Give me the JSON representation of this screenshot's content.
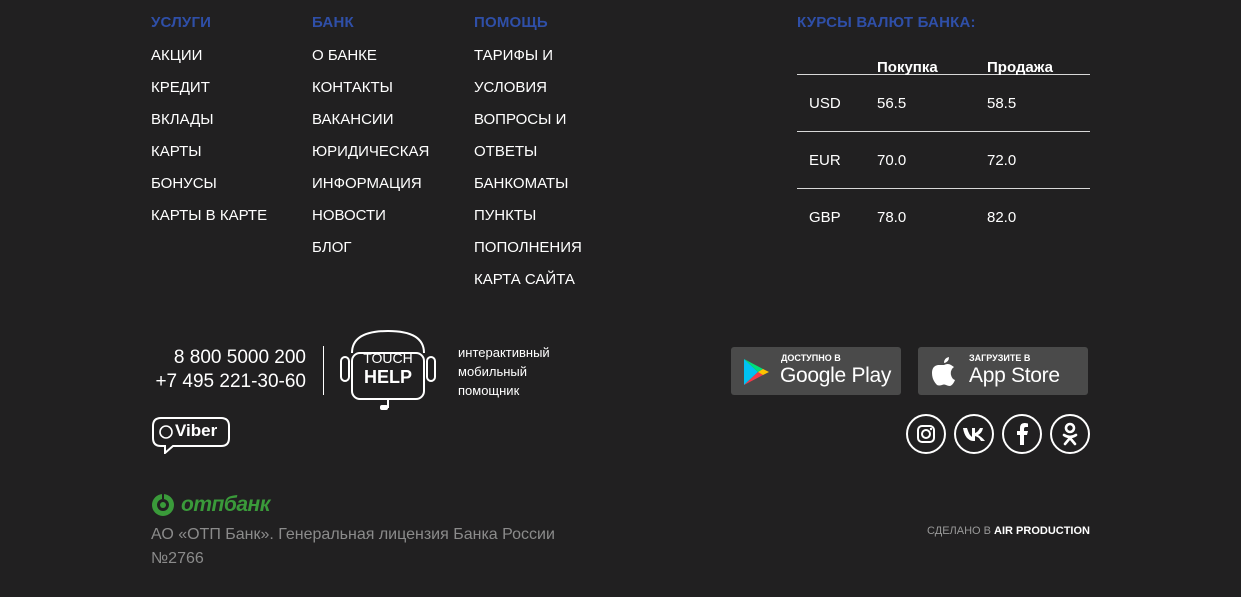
{
  "nav": {
    "services": {
      "title": "УСЛУГИ",
      "items": [
        "АКЦИИ",
        "КРЕДИТ",
        "ВКЛАДЫ",
        "КАРТЫ",
        "БОНУСЫ",
        "КАРТЫ В КАРТЕ"
      ]
    },
    "bank": {
      "title": "БАНК",
      "items": [
        "О БАНКЕ",
        "КОНТАКТЫ",
        "ВАКАНСИИ",
        "ЮРИДИЧЕСКАЯ",
        "ИНФОРМАЦИЯ",
        "НОВОСТИ",
        "БЛОГ"
      ]
    },
    "help": {
      "title": "ПОМОЩЬ",
      "items": [
        "ТАРИФЫ И",
        "УСЛОВИЯ",
        "ВОПРОСЫ И",
        "ОТВЕТЫ",
        "БАНКОМАТЫ",
        "ПУНКТЫ",
        "ПОПОЛНЕНИЯ",
        "КАРТА САЙТА"
      ]
    }
  },
  "rates": {
    "title": "КУРСЫ ВАЛЮТ БАНКА:",
    "buy_label": "Покупка",
    "sell_label": "Продажа",
    "rows": [
      {
        "currency": "USD",
        "buy": "56.5",
        "sell": "58.5"
      },
      {
        "currency": "EUR",
        "buy": "70.0",
        "sell": "72.0"
      },
      {
        "currency": "GBP",
        "buy": "78.0",
        "sell": "82.0"
      }
    ]
  },
  "contacts": {
    "phone1": "8 800 5000 200",
    "phone2": "+7 495 221-30-60",
    "touch_line1": "TOUCH",
    "touch_line2": "HELP",
    "touch_desc": [
      "интерактивный",
      "мобильный",
      "помощник"
    ],
    "viber": "Viber"
  },
  "apps": {
    "google": {
      "small": "ДОСТУПНО В",
      "big": "Google Play"
    },
    "apple": {
      "small": "ЗАГРУЗИТЕ В",
      "big": "App Store"
    }
  },
  "social": [
    "instagram-icon",
    "vk-icon",
    "facebook-icon",
    "odnoklassniki-icon"
  ],
  "footer": {
    "logo_text": "отпбанк",
    "license_line1": "АО «ОТП Банк». Генеральная лицензия Банка России",
    "license_line2": "№2766",
    "credit_prefix": "СДЕЛАНО В",
    "credit_name": "AIR PRODUCTION"
  },
  "colors": {
    "background": "#212021",
    "heading": "#2f4fa8",
    "logo_green": "#3a9a3a"
  }
}
